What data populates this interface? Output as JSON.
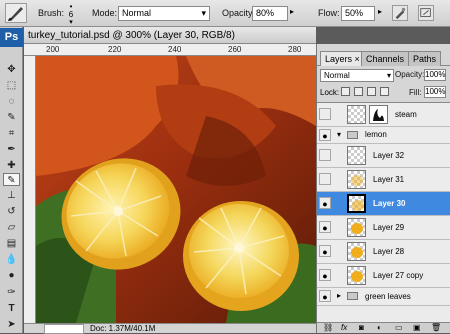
{
  "options": {
    "brush_label": "Brush:",
    "brush_size": "6",
    "mode_label": "Mode:",
    "mode_value": "Normal",
    "opacity_label": "Opacity:",
    "opacity_value": "80%",
    "flow_label": "Flow:",
    "flow_value": "50%"
  },
  "toolbar": {
    "logo": "Ps",
    "tools": [
      "move-tool",
      "marquee-tool",
      "lasso-tool",
      "quick-select-tool",
      "crop-tool",
      "eyedropper-tool",
      "healing-tool",
      "brush-tool",
      "stamp-tool",
      "history-brush-tool",
      "eraser-tool",
      "gradient-tool",
      "blur-tool",
      "dodge-tool",
      "pen-tool",
      "type-tool",
      "path-select-tool"
    ],
    "selected_tool": "brush-tool"
  },
  "document": {
    "title": "turkey_tutorial.psd @ 300% (Layer 30, RGB/8)",
    "ruler_ticks": [
      "200",
      "220",
      "240",
      "260",
      "280"
    ],
    "status": "Doc: 1.37M/40.1M"
  },
  "layers_panel": {
    "tabs": [
      "Layers ×",
      "Channels",
      "Paths"
    ],
    "active_tab": "Layers ×",
    "blend_mode": "Normal",
    "opacity_label": "Opacity:",
    "opacity_value": "100%",
    "lock_label": "Lock:",
    "fill_label": "Fill:",
    "fill_value": "100%",
    "layers": [
      {
        "name": "steam",
        "visible": false,
        "kind": "layer-mask"
      },
      {
        "name": "lemon",
        "visible": true,
        "kind": "group"
      },
      {
        "name": "Layer 32",
        "visible": false,
        "kind": "layer"
      },
      {
        "name": "Layer 31",
        "visible": false,
        "kind": "layer"
      },
      {
        "name": "Layer 30",
        "visible": true,
        "kind": "layer",
        "selected": true
      },
      {
        "name": "Layer 29",
        "visible": true,
        "kind": "layer"
      },
      {
        "name": "Layer 28",
        "visible": true,
        "kind": "layer"
      },
      {
        "name": "Layer 27 copy",
        "visible": true,
        "kind": "layer"
      },
      {
        "name": "green leaves",
        "visible": true,
        "kind": "group"
      }
    ]
  },
  "colors": {
    "selection": "#3f89e0",
    "ps_blue": "#1f5ea8",
    "lemon": "#f0ad1d"
  }
}
